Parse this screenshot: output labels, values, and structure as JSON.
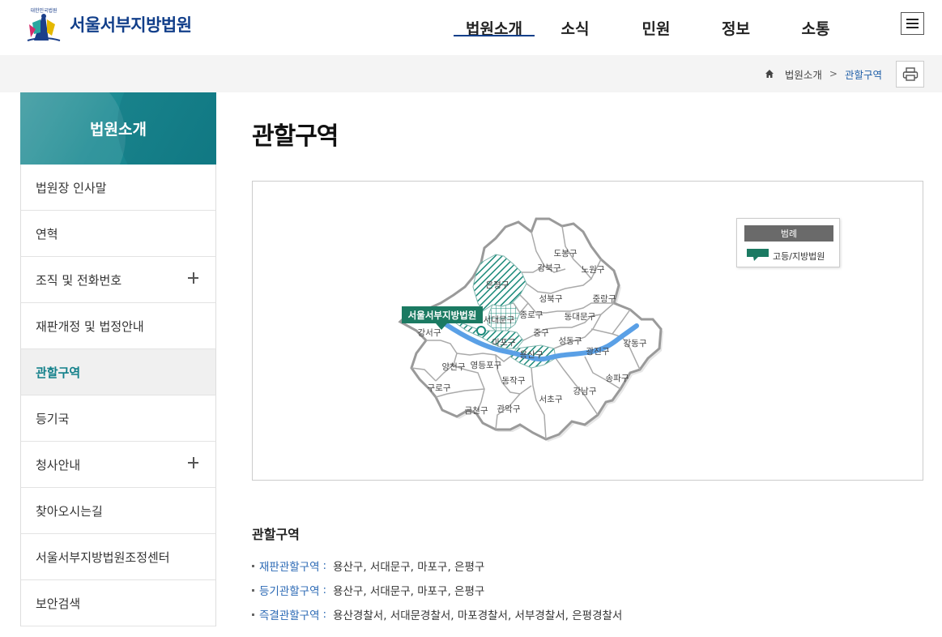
{
  "header": {
    "logo_text": "서울서부지방법원",
    "logo_caption": "대한민국법원",
    "nav": [
      "법원소개",
      "소식",
      "민원",
      "정보",
      "소통"
    ],
    "nav_active": "법원소개"
  },
  "breadcrumb": {
    "items": [
      "법원소개",
      "관할구역"
    ]
  },
  "sidebar": {
    "title": "법원소개",
    "items": [
      {
        "label": "법원장 인사말",
        "expandable": false
      },
      {
        "label": "연혁",
        "expandable": false
      },
      {
        "label": "조직 및 전화번호",
        "expandable": true
      },
      {
        "label": "재판개정 및 법정안내",
        "expandable": false
      },
      {
        "label": "관할구역",
        "expandable": false,
        "active": true
      },
      {
        "label": "등기국",
        "expandable": false
      },
      {
        "label": "청사안내",
        "expandable": true
      },
      {
        "label": "찾아오시는길",
        "expandable": false
      },
      {
        "label": "서울서부지방법원조정센터",
        "expandable": false
      },
      {
        "label": "보안검색",
        "expandable": false
      }
    ]
  },
  "page_title": "관할구역",
  "map": {
    "court_label": "서울서부지방법원",
    "legend_title": "범례",
    "legend_label": "고등/지방법원",
    "districts": [
      "도봉구",
      "강북구",
      "노원구",
      "은평구",
      "성북구",
      "중랑구",
      "종로구",
      "동대문구",
      "서대문구",
      "강서구",
      "중구",
      "성동구",
      "마포구",
      "광진구",
      "강동구",
      "용산구",
      "양천구",
      "영등포구",
      "송파구",
      "동작구",
      "구로구",
      "강남구",
      "서초구",
      "금천구",
      "관악구"
    ],
    "colors": {
      "teal": "#1b8a7a",
      "river": "#5aa0e6",
      "border": "#999999"
    }
  },
  "section": {
    "title": "관할구역",
    "rows": [
      {
        "key": "재판관할구역",
        "value": "용산구, 서대문구, 마포구, 은평구"
      },
      {
        "key": "등기관할구역",
        "value": "용산구, 서대문구, 마포구, 은평구"
      },
      {
        "key": "즉결관할구역",
        "value": "용산경찰서, 서대문경찰서, 마포경찰서, 서부경찰서, 은평경찰서"
      }
    ]
  }
}
